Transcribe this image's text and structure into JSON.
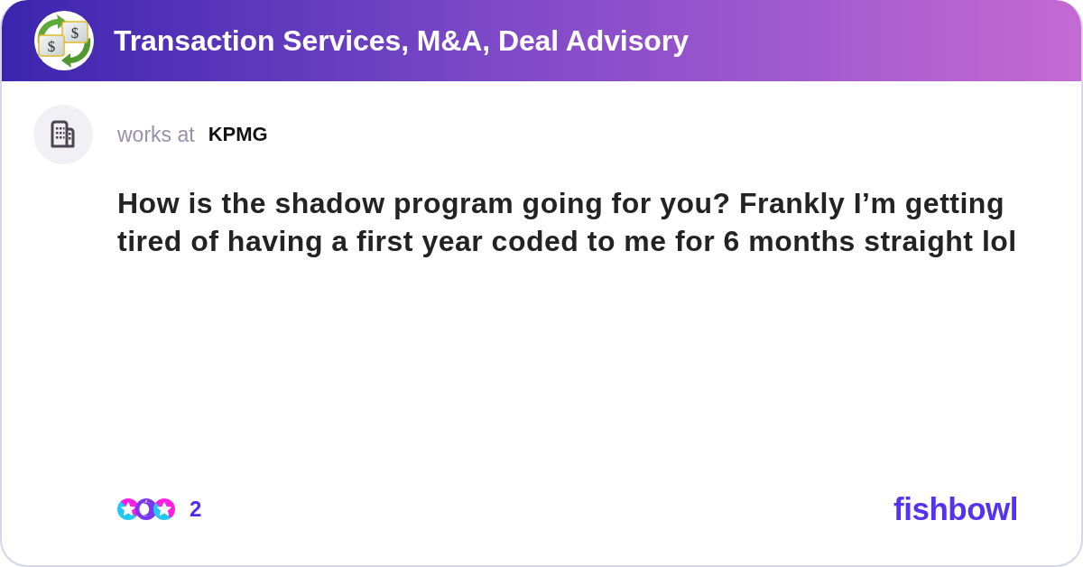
{
  "header": {
    "logo_symbols": [
      "$",
      "$"
    ],
    "title": "Transaction Services, M&A, Deal Advisory"
  },
  "post": {
    "author_prefix": "works at",
    "company": "KPMG",
    "text": "How is the shadow program going for you? Frankly I’m getting tired of having a first year coded to me for 6 months straight lol"
  },
  "footer": {
    "reaction_count": "2",
    "brand": "fishbowl"
  }
}
